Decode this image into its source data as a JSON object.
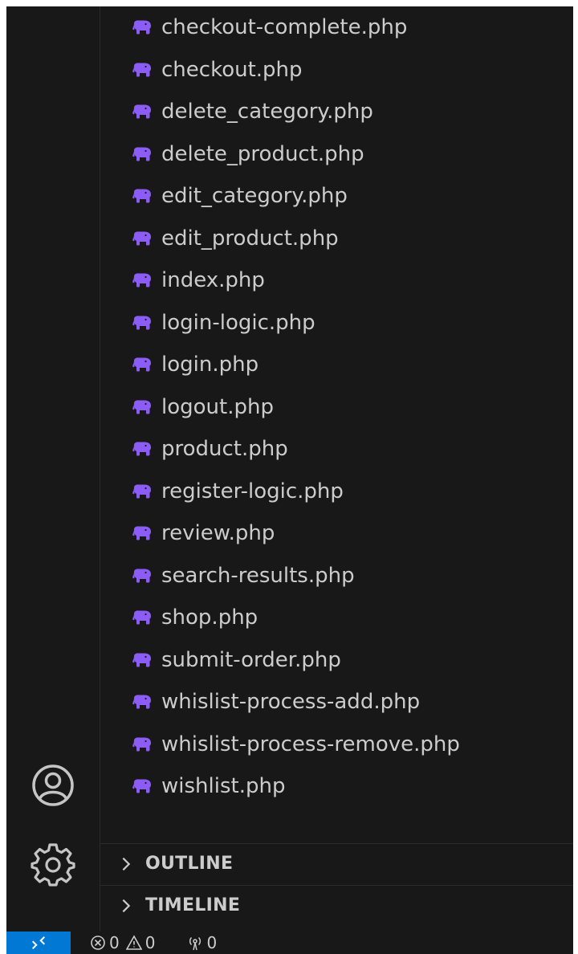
{
  "explorer": {
    "files": [
      {
        "name": "checkout-complete.php",
        "icon": "php-elephant-icon"
      },
      {
        "name": "checkout.php",
        "icon": "php-elephant-icon"
      },
      {
        "name": "delete_category.php",
        "icon": "php-elephant-icon"
      },
      {
        "name": "delete_product.php",
        "icon": "php-elephant-icon"
      },
      {
        "name": "edit_category.php",
        "icon": "php-elephant-icon"
      },
      {
        "name": "edit_product.php",
        "icon": "php-elephant-icon"
      },
      {
        "name": "index.php",
        "icon": "php-elephant-icon"
      },
      {
        "name": "login-logic.php",
        "icon": "php-elephant-icon"
      },
      {
        "name": "login.php",
        "icon": "php-elephant-icon"
      },
      {
        "name": "logout.php",
        "icon": "php-elephant-icon"
      },
      {
        "name": "product.php",
        "icon": "php-elephant-icon"
      },
      {
        "name": "register-logic.php",
        "icon": "php-elephant-icon"
      },
      {
        "name": "review.php",
        "icon": "php-elephant-icon"
      },
      {
        "name": "search-results.php",
        "icon": "php-elephant-icon"
      },
      {
        "name": "shop.php",
        "icon": "php-elephant-icon"
      },
      {
        "name": "submit-order.php",
        "icon": "php-elephant-icon"
      },
      {
        "name": "whislist-process-add.php",
        "icon": "php-elephant-icon"
      },
      {
        "name": "whislist-process-remove.php",
        "icon": "php-elephant-icon"
      },
      {
        "name": "wishlist.php",
        "icon": "php-elephant-icon"
      }
    ]
  },
  "sections": {
    "outline_label": "OUTLINE",
    "timeline_label": "TIMELINE"
  },
  "activity_bar": {
    "accounts_icon": "account-icon",
    "settings_icon": "gear-icon"
  },
  "status_bar": {
    "remote_icon": "remote-icon",
    "errors": "0",
    "warnings": "0",
    "ports": "0"
  },
  "colors": {
    "php_icon": "#8b5cf6",
    "remote_bg": "#0078d4",
    "background": "#181818",
    "text": "#cccccc"
  }
}
